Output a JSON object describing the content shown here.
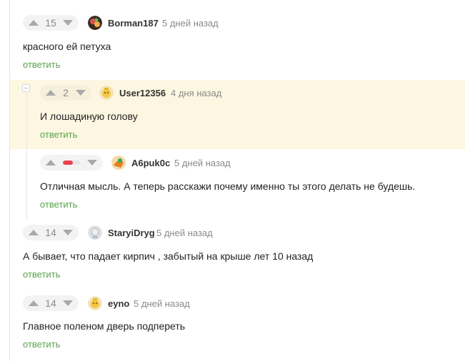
{
  "comments": [
    {
      "votes": "15",
      "username": "Borman187",
      "time": "5 дней назад",
      "text": "красного ей петуха",
      "reply": "ответить"
    },
    {
      "votes": "2",
      "username": "User12356",
      "time": "4 дня назад",
      "text": "И лошадиную голову",
      "reply": "ответить"
    },
    {
      "rating_negative_fraction": 0.6,
      "username": "A6puk0c",
      "time": "5 дней назад",
      "text": "Отличная мысль. А теперь расскажи почему именно ты этого делать не будешь.",
      "reply": "ответить"
    },
    {
      "votes": "14",
      "username": "StaryiDryg",
      "time": "5 дней назад",
      "text": "А бывает, что падает кирпич , забытый на крыше лет 10 назад",
      "reply": "ответить"
    },
    {
      "votes": "14",
      "username": "eyno",
      "time": "5 дней назад",
      "text": "Главное поленом дверь подпереть",
      "reply": "ответить"
    }
  ],
  "colors": {
    "accent_green": "#58a44a",
    "highlight": "#fdf6e1",
    "negative": "#e8434f"
  },
  "icons": {
    "upvote": "arrow-up-icon",
    "downvote": "arrow-down-icon",
    "collapse": "collapse-minus-icon"
  }
}
